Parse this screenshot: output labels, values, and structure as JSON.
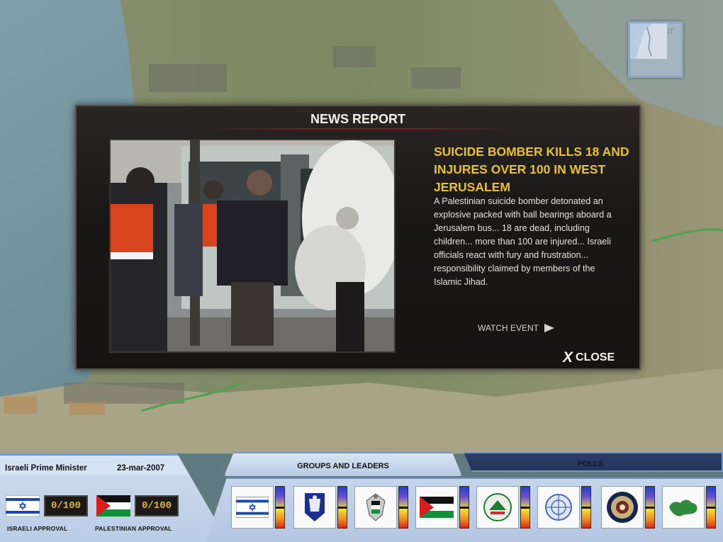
{
  "map": {
    "zoom_out_label": "ZOOM OUT"
  },
  "news": {
    "window_title": "NEWS REPORT",
    "headline": "SUICIDE BOMBER KILLS 18 AND INJURES OVER 100 IN WEST JERUSALEM",
    "body": "A Palestinian suicide bomber detonated an explosive packed with ball bearings aboard a Jerusalem bus... 18 are dead, including children... more than 100 are injured... Israeli officials react with fury and frustration... responsibility claimed by members of the Islamic Jihad.",
    "watch_label": "WATCH EVENT",
    "close_label": "CLOSE",
    "close_glyph": "X"
  },
  "status": {
    "role": "Israeli Prime Minister",
    "date": "23-mar-2007",
    "israeli_score": "0/100",
    "israeli_label": "ISRAELI APPROVAL",
    "palestinian_score": "0/100",
    "palestinian_label": "PALESTINIAN APPROVAL"
  },
  "tabs": {
    "groups_label": "GROUPS AND LEADERS",
    "polls_label": "POLLS"
  },
  "leaders": [
    {
      "icon": "israel-flag-icon"
    },
    {
      "icon": "israeli-police-emblem-icon"
    },
    {
      "icon": "palestinian-authority-emblem-icon"
    },
    {
      "icon": "palestine-flag-icon"
    },
    {
      "icon": "hamas-emblem-icon"
    },
    {
      "icon": "un-emblem-icon"
    },
    {
      "icon": "us-presidential-seal-icon"
    },
    {
      "icon": "arab-league-emblem-icon"
    }
  ],
  "colors": {
    "headline": "#e8c131",
    "modal_bg": "#1a1717",
    "hud_blue": "#c6d7ec",
    "polls_tab": "#2c3e68",
    "score_text": "#e0b43a"
  }
}
